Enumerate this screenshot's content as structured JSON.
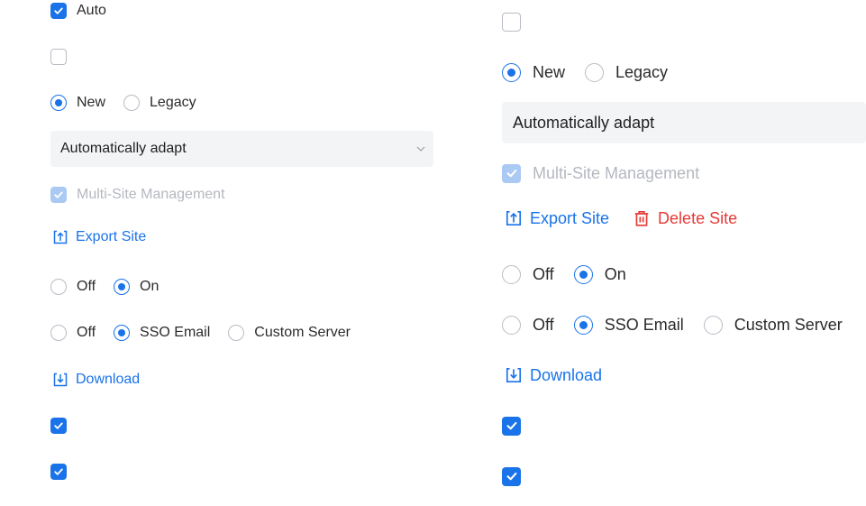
{
  "left": {
    "auto_checkbox": {
      "checked": true,
      "label": "Auto"
    },
    "empty_checkbox": {
      "checked": false
    },
    "engine_radio": {
      "options": [
        "New",
        "Legacy"
      ],
      "selected": "New"
    },
    "adapt_select": {
      "value": "Automatically adapt"
    },
    "multisite_checkbox": {
      "checked": true,
      "disabled": true,
      "label": "Multi-Site Management"
    },
    "export_link": {
      "label": "Export Site",
      "icon": "export-icon"
    },
    "toggle_radio": {
      "options": [
        "Off",
        "On"
      ],
      "selected": "On"
    },
    "mail_radio": {
      "options": [
        "Off",
        "SSO Email",
        "Custom Server"
      ],
      "selected": "SSO Email"
    },
    "download_link": {
      "label": "Download",
      "icon": "download-icon"
    },
    "check_a": {
      "checked": true
    },
    "check_b": {
      "checked": true
    }
  },
  "right": {
    "empty_checkbox": {
      "checked": false
    },
    "engine_radio": {
      "options": [
        "New",
        "Legacy"
      ],
      "selected": "New"
    },
    "adapt_select": {
      "value": "Automatically adapt"
    },
    "multisite_checkbox": {
      "checked": true,
      "disabled": true,
      "label": "Multi-Site Management"
    },
    "export_link": {
      "label": "Export Site",
      "icon": "export-icon"
    },
    "delete_link": {
      "label": "Delete Site",
      "icon": "trash-icon"
    },
    "toggle_radio": {
      "options": [
        "Off",
        "On"
      ],
      "selected": "On"
    },
    "mail_radio": {
      "options": [
        "Off",
        "SSO Email",
        "Custom Server"
      ],
      "selected": "SSO Email"
    },
    "download_link": {
      "label": "Download",
      "icon": "download-icon"
    },
    "check_a": {
      "checked": true
    },
    "check_b": {
      "checked": true
    }
  },
  "colors": {
    "primary": "#1a73e8",
    "danger": "#e53935",
    "disabled_check": "#aac9f3",
    "select_bg": "#f3f4f6"
  }
}
